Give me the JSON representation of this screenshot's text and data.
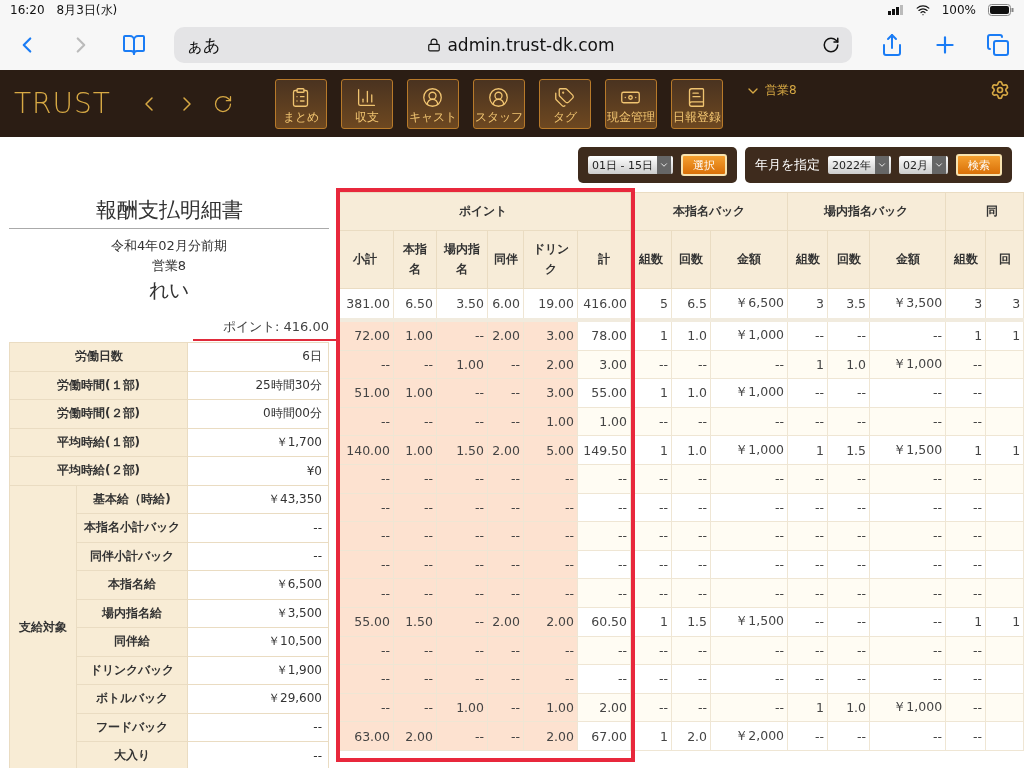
{
  "status_bar": {
    "time": "16:20",
    "date": "8月3日(水)",
    "battery": "100%"
  },
  "browser": {
    "text_size": "ぁあ",
    "url": "admin.trust-dk.com"
  },
  "app_header": {
    "logo": "TRUST",
    "nav": [
      {
        "label": "まとめ",
        "kind": "clipboard"
      },
      {
        "label": "収支",
        "kind": "chart"
      },
      {
        "label": "キャスト",
        "kind": "person"
      },
      {
        "label": "スタッフ",
        "kind": "person"
      },
      {
        "label": "タグ",
        "kind": "tag"
      },
      {
        "label": "現金管理",
        "kind": "money"
      },
      {
        "label": "日報登録",
        "kind": "book"
      }
    ],
    "store": "営業8"
  },
  "filters": {
    "period": "01日 - 15日",
    "select_button": "選択",
    "label": "年月を指定",
    "year": "2022年",
    "month": "02月",
    "search_button": "検索"
  },
  "statement": {
    "title": "報酬支払明細書",
    "period": "令和4年02月分前期",
    "store": "営業8",
    "name": "れい",
    "points": "ポイント: 416.00",
    "summary_rows": [
      {
        "label": "労働日数",
        "value": "6日"
      },
      {
        "label": "労働時間(１部)",
        "value": "25時間30分"
      },
      {
        "label": "労働時間(２部)",
        "value": "0時間00分"
      },
      {
        "label": "平均時給(１部)",
        "value": "￥1,700"
      },
      {
        "label": "平均時給(２部)",
        "value": "¥0"
      }
    ],
    "payment_group": {
      "label": "支給対象",
      "rows": [
        {
          "label": "基本給（時給)",
          "value": "￥43,350"
        },
        {
          "label": "本指名小計バック",
          "value": "--"
        },
        {
          "label": "同伴小計バック",
          "value": "--"
        },
        {
          "label": "本指名給",
          "value": "￥6,500"
        },
        {
          "label": "場内指名給",
          "value": "￥3,500"
        },
        {
          "label": "同伴給",
          "value": "￥10,500"
        },
        {
          "label": "ドリンクバック",
          "value": "￥1,900"
        },
        {
          "label": "ボトルバック",
          "value": "￥29,600"
        },
        {
          "label": "フードバック",
          "value": "--"
        },
        {
          "label": "大入り",
          "value": "--"
        }
      ]
    }
  },
  "breakdown": {
    "groups": [
      {
        "label": "ポイント",
        "columns": [
          "小計",
          "本指名",
          "場内指名",
          "同伴",
          "ドリンク",
          "計"
        ]
      },
      {
        "label": "本指名バック",
        "columns": [
          "組数",
          "回数",
          "金額"
        ]
      },
      {
        "label": "場内指名バック",
        "columns": [
          "組数",
          "回数",
          "金額"
        ]
      },
      {
        "label": "同",
        "columns": [
          "組数",
          "回"
        ]
      }
    ],
    "total": [
      "381.00",
      "6.50",
      "3.50",
      "6.00",
      "19.00",
      "416.00",
      "5",
      "6.5",
      "￥6,500",
      "3",
      "3.5",
      "￥3,500",
      "3",
      "3"
    ],
    "rows": [
      [
        "72.00",
        "1.00",
        "--",
        "2.00",
        "3.00",
        "78.00",
        "1",
        "1.0",
        "￥1,000",
        "--",
        "--",
        "--",
        "1",
        "1"
      ],
      [
        "--",
        "--",
        "1.00",
        "--",
        "2.00",
        "3.00",
        "--",
        "--",
        "--",
        "1",
        "1.0",
        "￥1,000",
        "--",
        ""
      ],
      [
        "51.00",
        "1.00",
        "--",
        "--",
        "3.00",
        "55.00",
        "1",
        "1.0",
        "￥1,000",
        "--",
        "--",
        "--",
        "--",
        ""
      ],
      [
        "--",
        "--",
        "--",
        "--",
        "1.00",
        "1.00",
        "--",
        "--",
        "--",
        "--",
        "--",
        "--",
        "--",
        ""
      ],
      [
        "140.00",
        "1.00",
        "1.50",
        "2.00",
        "5.00",
        "149.50",
        "1",
        "1.0",
        "￥1,000",
        "1",
        "1.5",
        "￥1,500",
        "1",
        "1"
      ],
      [
        "--",
        "--",
        "--",
        "--",
        "--",
        "--",
        "--",
        "--",
        "--",
        "--",
        "--",
        "--",
        "--",
        ""
      ],
      [
        "--",
        "--",
        "--",
        "--",
        "--",
        "--",
        "--",
        "--",
        "--",
        "--",
        "--",
        "--",
        "--",
        ""
      ],
      [
        "--",
        "--",
        "--",
        "--",
        "--",
        "--",
        "--",
        "--",
        "--",
        "--",
        "--",
        "--",
        "--",
        ""
      ],
      [
        "--",
        "--",
        "--",
        "--",
        "--",
        "--",
        "--",
        "--",
        "--",
        "--",
        "--",
        "--",
        "--",
        ""
      ],
      [
        "--",
        "--",
        "--",
        "--",
        "--",
        "--",
        "--",
        "--",
        "--",
        "--",
        "--",
        "--",
        "--",
        ""
      ],
      [
        "55.00",
        "1.50",
        "--",
        "2.00",
        "2.00",
        "60.50",
        "1",
        "1.5",
        "￥1,500",
        "--",
        "--",
        "--",
        "1",
        "1"
      ],
      [
        "--",
        "--",
        "--",
        "--",
        "--",
        "--",
        "--",
        "--",
        "--",
        "--",
        "--",
        "--",
        "--",
        ""
      ],
      [
        "--",
        "--",
        "--",
        "--",
        "--",
        "--",
        "--",
        "--",
        "--",
        "--",
        "--",
        "--",
        "--",
        ""
      ],
      [
        "--",
        "--",
        "1.00",
        "--",
        "1.00",
        "2.00",
        "--",
        "--",
        "--",
        "1",
        "1.0",
        "￥1,000",
        "--",
        ""
      ],
      [
        "63.00",
        "2.00",
        "--",
        "--",
        "2.00",
        "67.00",
        "1",
        "2.0",
        "￥2,000",
        "--",
        "--",
        "--",
        "--",
        ""
      ]
    ]
  }
}
